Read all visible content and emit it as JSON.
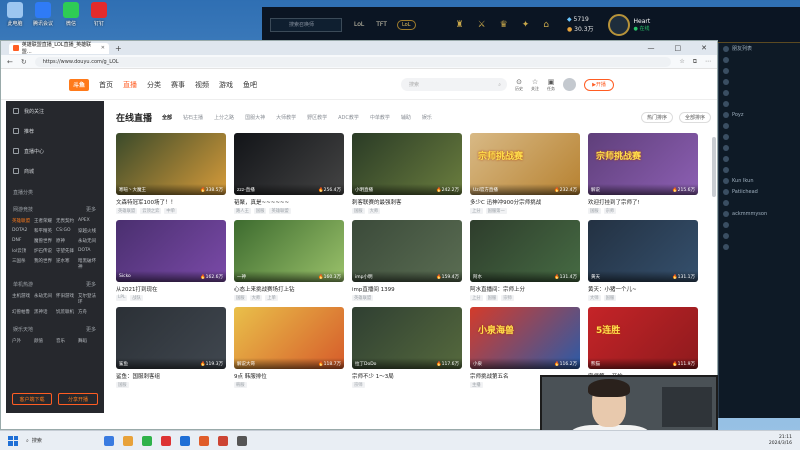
{
  "desktop_icons": [
    {
      "label": "此电脑",
      "color": "#9cc6f0"
    },
    {
      "label": "腾讯会议",
      "color": "#2f7bf6"
    },
    {
      "label": "微信",
      "color": "#2ecc55"
    },
    {
      "label": "钉钉",
      "color": "#e32b2b"
    }
  ],
  "lol_client": {
    "search_placeholder": "搜索召唤师",
    "modes": [
      "LoL",
      "TFT"
    ],
    "lol_pill": "LoL",
    "currency_blue": "5719",
    "currency_orange": "30.3万",
    "player_name": "Heart",
    "player_status": "● 在线"
  },
  "friends": [
    "朋友列表",
    "",
    "",
    "",
    "",
    "",
    "Poyz",
    "",
    "",
    "",
    "",
    "",
    "Kun Ikun",
    "Patiichead",
    "",
    "ackmmmyson",
    "",
    "",
    ""
  ],
  "browser": {
    "tab_title": "英雄联盟直播_LOL直播_英雄联盟…",
    "new_tab": "+",
    "url": "https://www.douyu.com/g_LOL",
    "win_controls": [
      "—",
      "□",
      "✕"
    ]
  },
  "topnav": {
    "logo": "斗鱼",
    "items": [
      "首页",
      "直播",
      "分类",
      "赛事",
      "视频",
      "游戏",
      "鱼吧"
    ],
    "active_index": 1,
    "search_placeholder": "搜索",
    "icons": [
      {
        "icon": "⊙",
        "label": "历史"
      },
      {
        "icon": "☆",
        "label": "关注"
      },
      {
        "icon": "▣",
        "label": "任务"
      }
    ],
    "live_button": "开播"
  },
  "sidebar": {
    "top_items": [
      "我的关注",
      "推荐",
      "直播中心",
      "商城"
    ],
    "section1": "直播分类",
    "section2": "网游竞技",
    "more": "更多",
    "games": [
      "英雄联盟",
      "王者荣耀",
      "无畏契约",
      "APEX",
      "DOTA2",
      "和平精英",
      "CS:GO",
      "穿越火线",
      "DNF",
      "魔兽世界",
      "原神",
      "永劫无间",
      "lol云顶",
      "炉石传说",
      "守望先锋",
      "DOTA",
      "三国杀",
      "我的世界",
      "逆水寒",
      "暗黑破坏神"
    ],
    "section3": "单机热游",
    "games2": [
      "主机游戏",
      "永劫无间",
      "怀旧游戏",
      "艾尔登法环",
      "幻兽帕鲁",
      "黑神话",
      "饥荒联机",
      "方舟"
    ],
    "section4": "娱乐天地",
    "games3": [
      "户外",
      "颜值",
      "音乐",
      "舞蹈"
    ],
    "buttons": [
      "客户端下载",
      "分享开播"
    ]
  },
  "main": {
    "title": "在线直播",
    "filters": [
      "全部",
      "钻石主播",
      "上分之路",
      "国服大神",
      "大师教学",
      "野区教学",
      "ADC教学",
      "中单教学",
      "辅助",
      "娱乐"
    ],
    "right_buttons": [
      "热门排序",
      "全部排序"
    ],
    "cards": [
      {
        "thumb": "#3a4a2a",
        "tag": "",
        "overlay": "",
        "streamer": "寒暄丶大魔王",
        "hot": "338.5万",
        "title": "文森特冠军100场了！！",
        "tags": [
          "英雄联盟",
          "云顶之弈",
          "中单"
        ],
        "accent": "#d69b3a"
      },
      {
        "thumb": "#121418",
        "tag": "",
        "overlay": "",
        "streamer": "zzz-直播",
        "hot": "256.4万",
        "title": "韬聚，真是~~~~~~",
        "tags": [
          "路人王",
          "国服",
          "英雄联盟"
        ],
        "accent": "#444"
      },
      {
        "thumb": "#2a3b26",
        "tag": "",
        "overlay": "",
        "streamer": "小明直播",
        "hot": "242.2万",
        "title": "刺客联赛的最强刺客",
        "tags": [
          "国服",
          "大师"
        ],
        "accent": "#6a7d3e"
      },
      {
        "thumb": "#d8b985",
        "tag": "",
        "overlay": "宗师挑战赛",
        "streamer": "Uzi官方直播",
        "hot": "232.4万",
        "title": "多少C 迅神冲900分宗师挑战",
        "tags": [
          "上分",
          "国服第一"
        ],
        "accent": "#b78231"
      },
      {
        "thumb": "#5f3f7a",
        "tag": "",
        "overlay": "宗师挑战赛",
        "streamer": "解说",
        "hot": "215.6万",
        "title": "欢迎打挂到了宗师了!",
        "tags": [
          "国服",
          "宗师"
        ],
        "accent": "#8c5fb3"
      },
      {
        "thumb": "#4a2f6f",
        "tag": "",
        "overlay": "",
        "streamer": "Sicko",
        "hot": "162.6万",
        "title": "从2021打到现在",
        "tags": [
          "LPL",
          "战队"
        ],
        "accent": "#7a4aa8"
      },
      {
        "thumb": "#3d6b2f",
        "tag": "",
        "overlay": "",
        "streamer": "一神",
        "hot": "160.3万",
        "title": "心态上来挑战赛场打上钻",
        "tags": [
          "国服",
          "大师",
          "上单"
        ],
        "accent": "#9ac16a"
      },
      {
        "thumb": "#3b4a3a",
        "tag": "",
        "overlay": "",
        "streamer": "imp小明",
        "hot": "159.4万",
        "title": "imp直播间 1399",
        "tags": [
          "英雄联盟"
        ],
        "accent": "#5a6d52"
      },
      {
        "thumb": "#2e3d2c",
        "tag": "",
        "overlay": "",
        "streamer": "阿水",
        "hot": "131.4万",
        "title": "阿水直播间：宗师上分",
        "tags": [
          "上分",
          "国服",
          "宗师"
        ],
        "accent": "#466b43"
      },
      {
        "thumb": "#233142",
        "tag": "",
        "overlay": "",
        "streamer": "黄天",
        "hot": "131.1万",
        "title": "黄天：小猪一个儿~",
        "tags": [
          "大师",
          "国服"
        ],
        "accent": "#35506d"
      },
      {
        "thumb": "#2b3036",
        "tag": "",
        "overlay": "",
        "streamer": "鲨鱼",
        "hot": "119.3万",
        "title": "鲨鱼：国服刺客组",
        "tags": [
          "国服"
        ],
        "accent": "#40474f"
      },
      {
        "thumb": "#e9c04a",
        "tag": "",
        "overlay": "",
        "streamer": "解说大哥",
        "hot": "118.7万",
        "title": "9点 韩服排位",
        "tags": [
          "韩服"
        ],
        "accent": "#d65b2a"
      },
      {
        "thumb": "#2f3f32",
        "tag": "",
        "overlay": "",
        "streamer": "拉丁DoDo",
        "hot": "117.6万",
        "title": "宗师不少 1～3局",
        "tags": [
          "宗师"
        ],
        "accent": "#55693d"
      },
      {
        "thumb": "#d43b2a",
        "tag": "",
        "overlay": "小泉海兽",
        "streamer": "小泉",
        "hot": "116.2万",
        "title": "宗师挑战第五名",
        "tags": [
          "主播"
        ],
        "accent": "#2a5ba8"
      },
      {
        "thumb": "#c52428",
        "tag": "",
        "overlay": "5连胜",
        "streamer": "熊猫",
        "hot": "111.9万",
        "title": "宗师第一 开始",
        "tags": [
          "国服"
        ],
        "accent": "#8e1a1d"
      }
    ]
  },
  "webcam": {
    "visible": true
  },
  "taskbar": {
    "search": "搜索",
    "time": "21:11",
    "date": "2024/3/16",
    "apps": [
      "#3a7be0",
      "#e8a23a",
      "#2fb24a",
      "#d33",
      "#1f6fd6",
      "#e05d2a",
      "#c43",
      "#555"
    ]
  }
}
